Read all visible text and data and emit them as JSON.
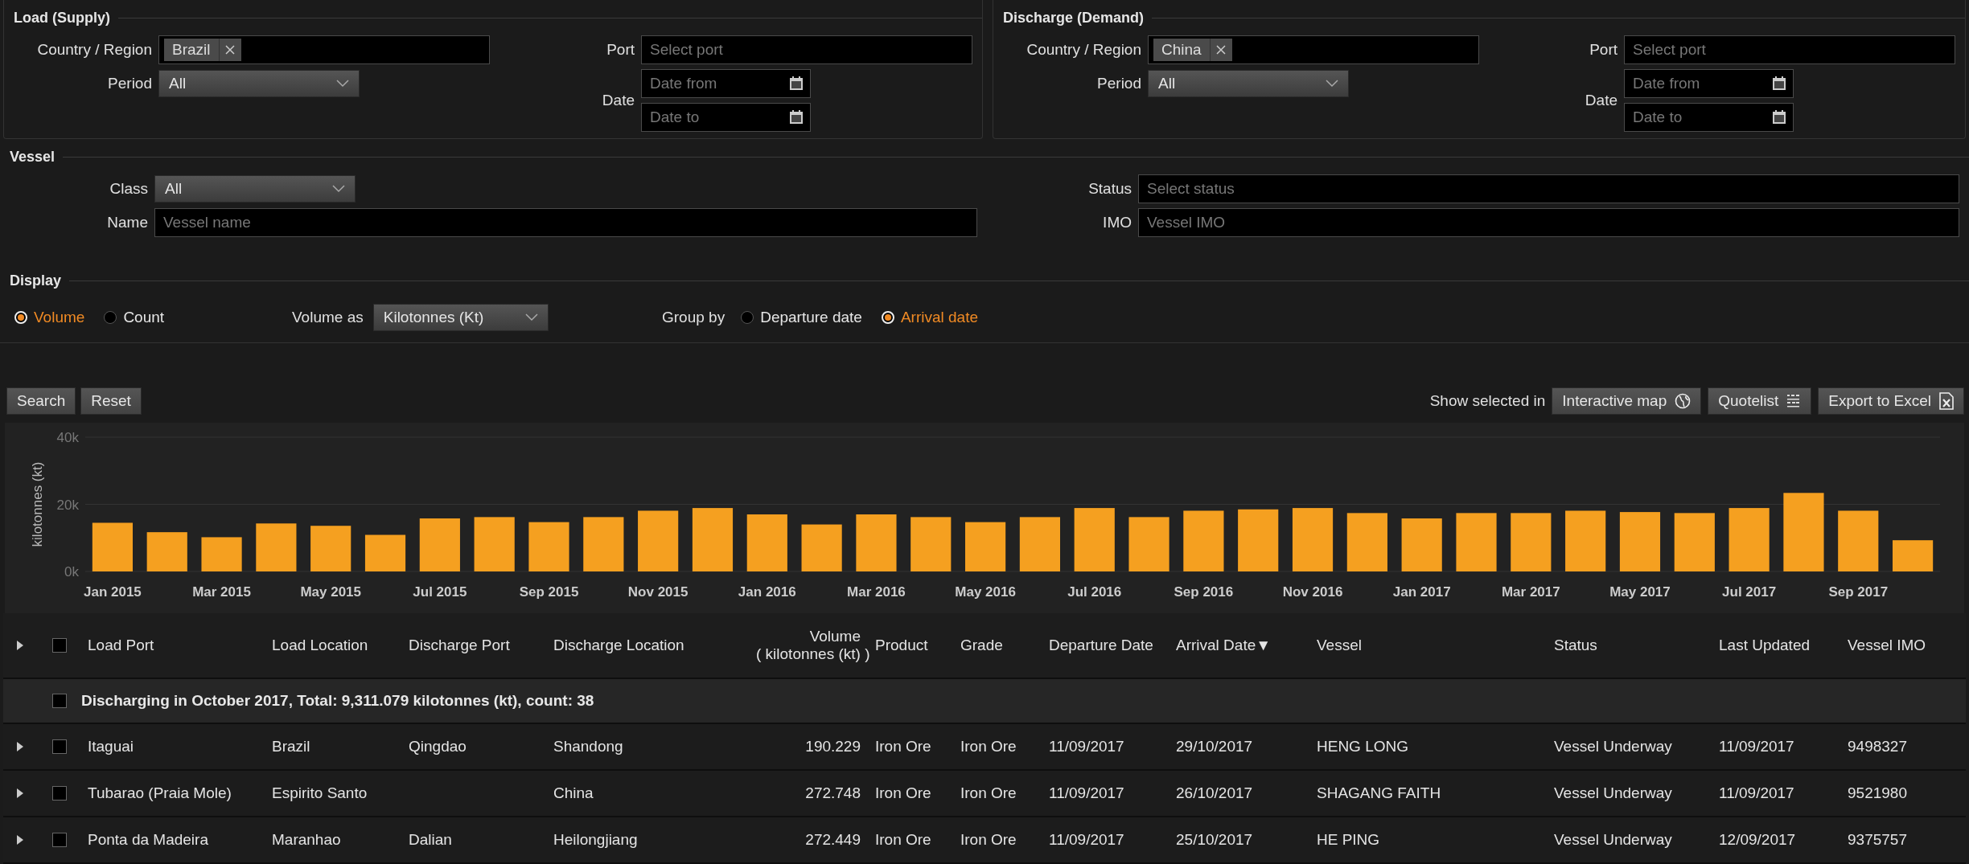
{
  "load": {
    "title": "Load (Supply)",
    "country_label": "Country / Region",
    "country_tag": "Brazil",
    "period_label": "Period",
    "period_value": "All",
    "port_label": "Port",
    "port_placeholder": "Select port",
    "date_label": "Date",
    "date_from_placeholder": "Date from",
    "date_to_placeholder": "Date to"
  },
  "discharge": {
    "title": "Discharge (Demand)",
    "country_label": "Country / Region",
    "country_tag": "China",
    "period_label": "Period",
    "period_value": "All",
    "port_label": "Port",
    "port_placeholder": "Select port",
    "date_label": "Date",
    "date_from_placeholder": "Date from",
    "date_to_placeholder": "Date to"
  },
  "vessel": {
    "title": "Vessel",
    "class_label": "Class",
    "class_value": "All",
    "name_label": "Name",
    "name_placeholder": "Vessel name",
    "status_label": "Status",
    "status_placeholder": "Select status",
    "imo_label": "IMO",
    "imo_placeholder": "Vessel IMO"
  },
  "display": {
    "title": "Display",
    "measure": [
      {
        "label": "Volume",
        "selected": true
      },
      {
        "label": "Count",
        "selected": false
      }
    ],
    "volume_as_label": "Volume as",
    "volume_as_value": "Kilotonnes (Kt)",
    "group_by_label": "Group by",
    "group_by": [
      {
        "label": "Departure date",
        "selected": false
      },
      {
        "label": "Arrival date",
        "selected": true
      }
    ]
  },
  "actions": {
    "buttons": [
      "Search",
      "Reset"
    ],
    "show_selected_label": "Show selected in",
    "exports": [
      {
        "label": "Interactive map",
        "kind": "map"
      },
      {
        "label": "Quotelist",
        "kind": "quotelist"
      },
      {
        "label": "Export to Excel",
        "kind": "excel"
      }
    ]
  },
  "chart": {
    "chart_data": {
      "type": "bar",
      "ylabel": "kilotonnes (kt)",
      "categories": [
        "Jan 2015",
        null,
        "Mar 2015",
        null,
        "May 2015",
        null,
        "Jul 2015",
        null,
        "Sep 2015",
        null,
        "Nov 2015",
        null,
        "Jan 2016",
        null,
        "Mar 2016",
        null,
        "May 2016",
        null,
        "Jul 2016",
        null,
        "Sep 2016",
        null,
        "Nov 2016",
        null,
        "Jan 2017",
        null,
        "Mar 2017",
        null,
        "May 2017",
        null,
        "Jul 2017",
        null,
        "Sep 2017",
        null
      ],
      "series": [
        {
          "color": "#f5a020",
          "values": [
            14500,
            11700,
            10200,
            14300,
            13600,
            10900,
            15800,
            16200,
            14700,
            16200,
            18100,
            18900,
            17000,
            14000,
            17000,
            16200,
            14700,
            16200,
            18900,
            16200,
            18100,
            18500,
            18900,
            17400,
            15800,
            17400,
            17400,
            18100,
            17700,
            17400,
            18900,
            23400,
            18100,
            9300
          ]
        }
      ],
      "ylim": [
        0,
        40000
      ],
      "yticks": [
        {
          "value": 0,
          "label": "0k"
        },
        {
          "value": 20000,
          "label": "20k"
        },
        {
          "value": 40000,
          "label": "40k"
        }
      ]
    }
  },
  "table": {
    "header_checked": false,
    "columns": [
      {
        "label": "Load Port",
        "kind": "text"
      },
      {
        "label": "Load Location",
        "kind": "text"
      },
      {
        "label": "Discharge Port",
        "kind": "text"
      },
      {
        "label": "Discharge Location",
        "kind": "text"
      },
      {
        "label": "Volume\n( kilotonnes (kt) )",
        "kind": "number"
      },
      {
        "label": "Product",
        "kind": "text"
      },
      {
        "label": "Grade",
        "kind": "text"
      },
      {
        "label": "Departure Date",
        "kind": "text"
      },
      {
        "label": "Arrival Date▼",
        "kind": "text"
      },
      {
        "label": "Vessel",
        "kind": "text"
      },
      {
        "label": "Status",
        "kind": "text"
      },
      {
        "label": "Last Updated",
        "kind": "text"
      },
      {
        "label": "Vessel IMO",
        "kind": "text"
      }
    ],
    "group": {
      "label": "Discharging in October 2017, Total: 9,311.079 kilotonnes (kt), count: 38",
      "checked": false
    },
    "rows": [
      {
        "checked": false,
        "cells": [
          "Itaguai",
          "Brazil",
          "Qingdao",
          "Shandong",
          "190.229",
          "Iron Ore",
          "Iron Ore",
          "11/09/2017",
          "29/10/2017",
          "HENG LONG",
          "Vessel Underway",
          "11/09/2017",
          "9498327"
        ]
      },
      {
        "checked": false,
        "cells": [
          "Tubarao (Praia Mole)",
          "Espirito Santo",
          "",
          "China",
          "272.748",
          "Iron Ore",
          "Iron Ore",
          "11/09/2017",
          "26/10/2017",
          "SHAGANG FAITH",
          "Vessel Underway",
          "11/09/2017",
          "9521980"
        ]
      },
      {
        "checked": false,
        "cells": [
          "Ponta da Madeira",
          "Maranhao",
          "Dalian",
          "Heilongjiang",
          "272.449",
          "Iron Ore",
          "Iron Ore",
          "11/09/2017",
          "25/10/2017",
          "HE PING",
          "Vessel Underway",
          "12/09/2017",
          "9375757"
        ]
      }
    ]
  }
}
